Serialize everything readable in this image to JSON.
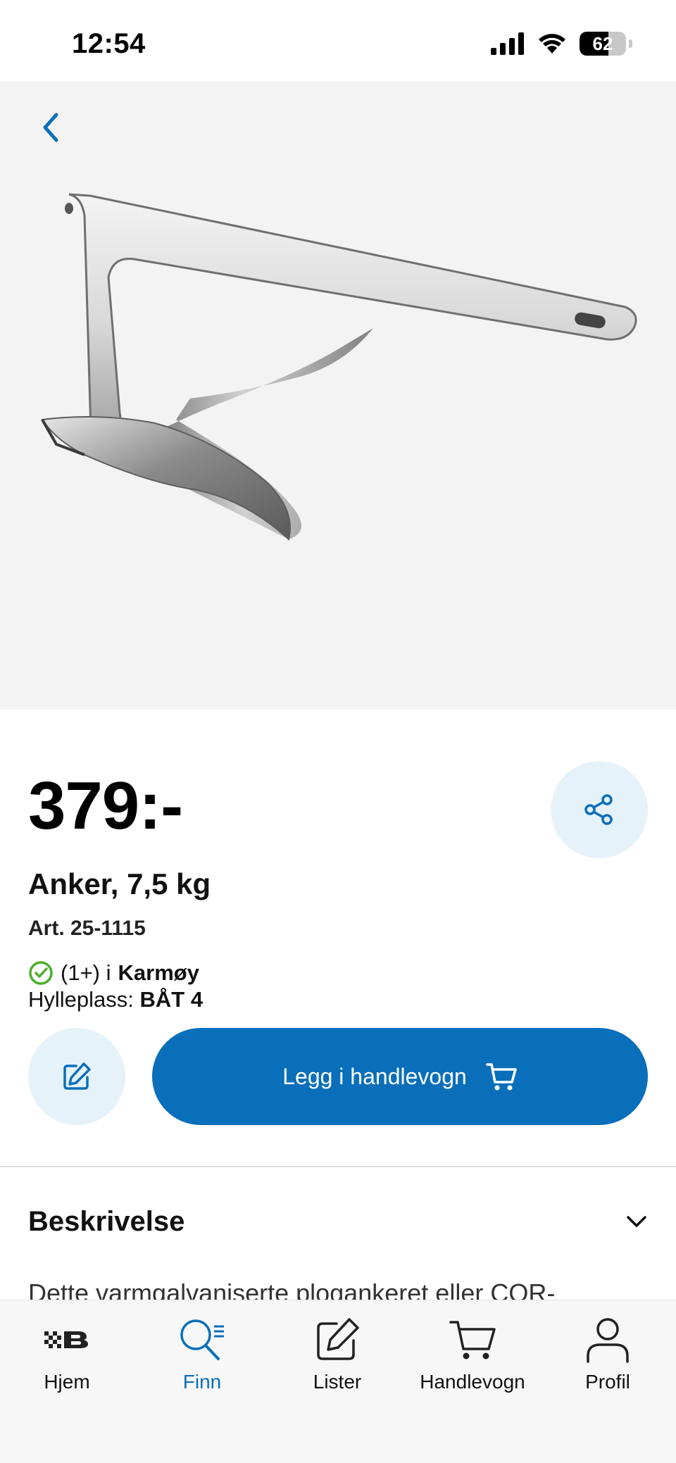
{
  "status_bar": {
    "time": "12:54",
    "battery_percent": 62,
    "battery_label": "62"
  },
  "product": {
    "price": "379:-",
    "title": "Anker, 7,5 kg",
    "article": "Art. 25-1115",
    "stock": {
      "count": "(1+) i",
      "store": "Karmøy"
    },
    "shelf": {
      "label": "Hylleplass:",
      "value": "BÅT 4"
    }
  },
  "actions": {
    "add_to_cart_label": "Legg i handlevogn"
  },
  "description": {
    "title": "Beskrivelse",
    "text": "Dette varmgalvaniserte plogankeret eller COR-"
  },
  "tab_bar": {
    "items": [
      {
        "label": "Hjem",
        "icon": "brand-logo-icon"
      },
      {
        "label": "Finn",
        "icon": "search-list-icon",
        "active": true
      },
      {
        "label": "Lister",
        "icon": "edit-icon"
      },
      {
        "label": "Handlevogn",
        "icon": "cart-icon"
      },
      {
        "label": "Profil",
        "icon": "person-icon"
      }
    ]
  },
  "colors": {
    "accent": "#0a6fba",
    "accent_light": "#e6f2fa",
    "success": "#4caf2a",
    "hero_background": "#f3f3f3"
  }
}
